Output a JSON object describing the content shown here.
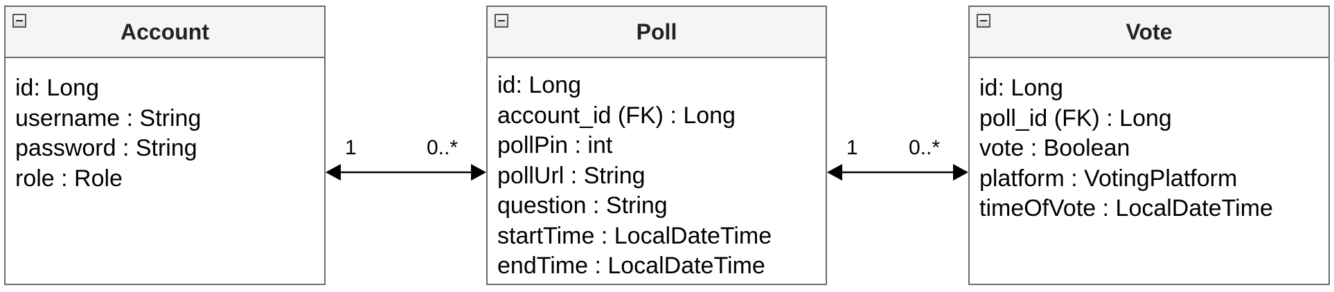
{
  "classes": [
    {
      "id": "account",
      "title": "Account",
      "attributes": [
        "id: Long",
        "username : String",
        "password : String",
        "role : Role"
      ]
    },
    {
      "id": "poll",
      "title": "Poll",
      "attributes": [
        "id: Long",
        "account_id (FK) : Long",
        "pollPin : int",
        "pollUrl : String",
        "question : String",
        "startTime : LocalDateTime",
        "endTime : LocalDateTime"
      ]
    },
    {
      "id": "vote",
      "title": "Vote",
      "attributes": [
        "id: Long",
        "poll_id (FK) : Long",
        "vote : Boolean",
        "platform : VotingPlatform",
        "timeOfVote : LocalDateTime"
      ]
    }
  ],
  "associations": [
    {
      "from": "Account",
      "to": "Poll",
      "from_multiplicity": "1",
      "to_multiplicity": "0..*"
    },
    {
      "from": "Poll",
      "to": "Vote",
      "from_multiplicity": "1",
      "to_multiplicity": "0..*"
    }
  ],
  "colors": {
    "border": "#6b6b6b",
    "header_bg": "#f5f5f5",
    "line": "#000000"
  }
}
